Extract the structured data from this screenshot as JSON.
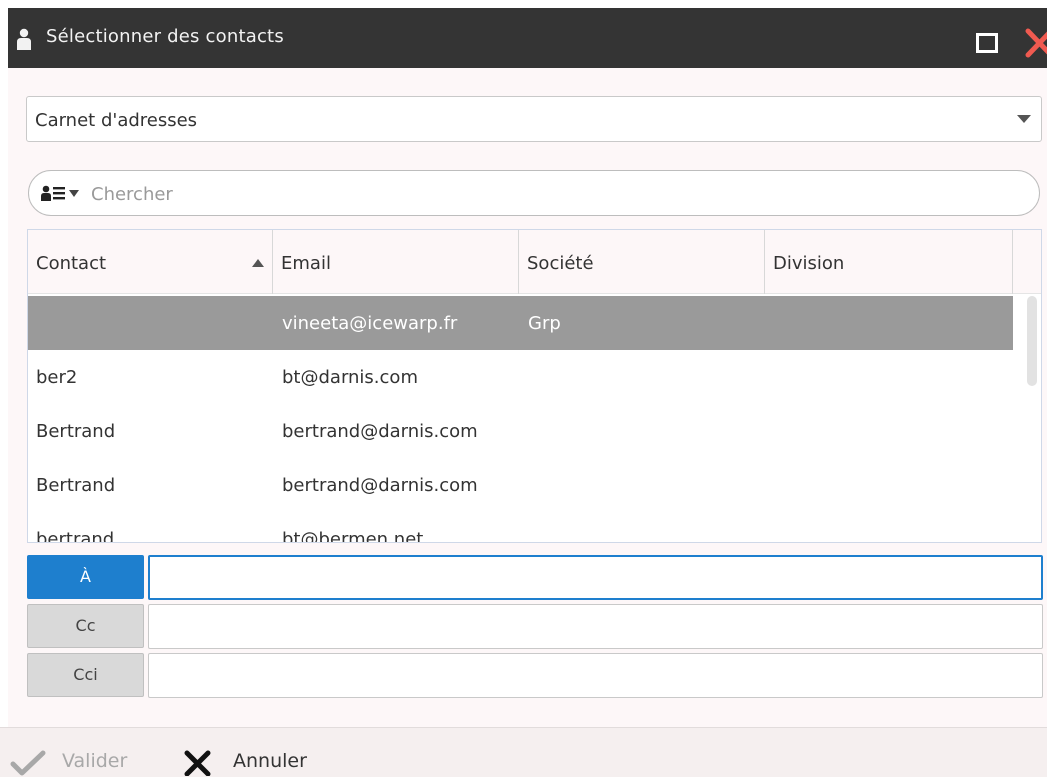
{
  "window": {
    "title": "Sélectionner des contacts"
  },
  "addressbook": {
    "selected": "Carnet d'adresses"
  },
  "search": {
    "placeholder": "Chercher"
  },
  "grid": {
    "columns": [
      "Contact",
      "Email",
      "Société",
      "Division"
    ],
    "sort_column": "Contact",
    "rows": [
      {
        "contact": "",
        "email": "vineeta@icewarp.fr",
        "company": "Grp",
        "division": "",
        "selected": true
      },
      {
        "contact": "ber2",
        "email": "bt@darnis.com",
        "company": "",
        "division": ""
      },
      {
        "contact": "Bertrand",
        "email": "bertrand@darnis.com",
        "company": "",
        "division": ""
      },
      {
        "contact": "Bertrand",
        "email": "bertrand@darnis.com",
        "company": "",
        "division": ""
      },
      {
        "contact": "bertrand",
        "email": "bt@bermen.net",
        "company": "",
        "division": ""
      }
    ]
  },
  "recipients": [
    {
      "label": "À",
      "value": "",
      "active": true
    },
    {
      "label": "Cc",
      "value": ""
    },
    {
      "label": "Cci",
      "value": ""
    }
  ],
  "footer": {
    "ok_label": "Valider",
    "cancel_label": "Annuler"
  },
  "icons": {
    "titlebar": "person-icon",
    "maximize": "maximize-icon",
    "close": "close-icon",
    "search_type": "contact-list-icon",
    "ok": "check-icon",
    "cancel": "x-icon"
  },
  "colors": {
    "accent": "#1e7fce",
    "close": "#f05a50",
    "selected_row": "#9a9a9a",
    "titlebar": "#343434"
  }
}
